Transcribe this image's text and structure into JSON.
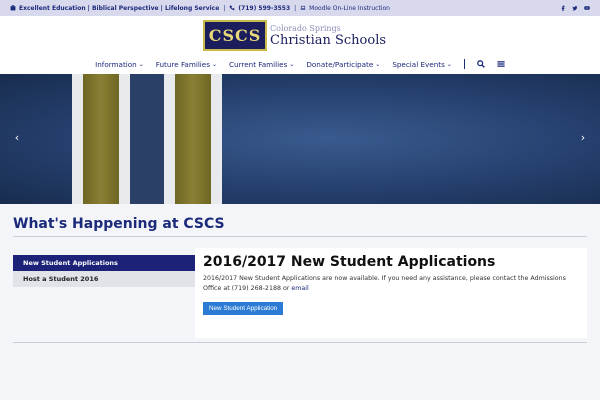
{
  "topbar": {
    "tagline": "Excellent Education | Biblical Perspective | Lifelong Service",
    "phone": "(719) 599-3553",
    "moodle": "Moodle On-Line Instruction",
    "social": [
      "facebook-icon",
      "twitter-icon",
      "youtube-icon"
    ]
  },
  "logo": {
    "mark": "CSCS",
    "line1": "Colorado Springs",
    "line2": "Christian Schools"
  },
  "nav": {
    "items": [
      {
        "label": "Information"
      },
      {
        "label": "Future Families"
      },
      {
        "label": "Current Families"
      },
      {
        "label": "Donate/Participate"
      },
      {
        "label": "Special Events"
      }
    ]
  },
  "hero": {
    "prev": "‹",
    "next": "›"
  },
  "main": {
    "heading": "What's Happening at CSCS",
    "tabs": [
      {
        "label": "New Student Applications"
      },
      {
        "label": "Host a Student 2016"
      }
    ],
    "panel": {
      "title": "2016/2017 New Student Applications",
      "body": "2016/2017 New Student Applications are now available. If you need any assistance, please contact the Admissions Office at (719) 268-2188 or",
      "link": "email",
      "button": "New Student Application"
    }
  },
  "colors": {
    "navy": "#1b2278",
    "gold": "#c9b84a",
    "button": "#2b7bd4"
  }
}
